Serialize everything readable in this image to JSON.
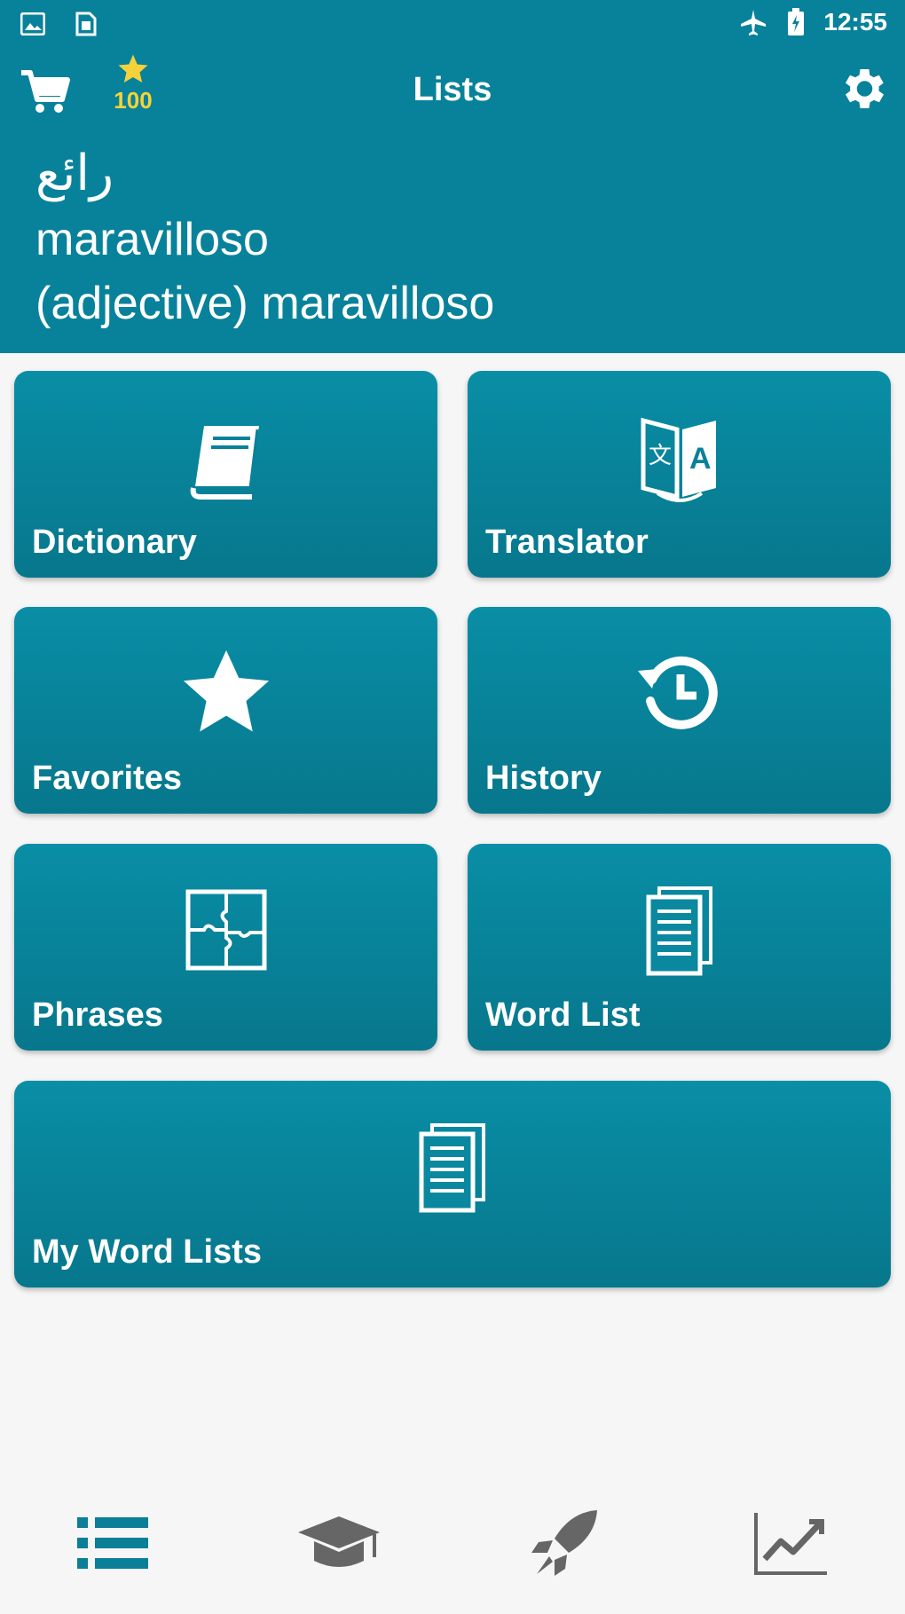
{
  "status_bar": {
    "time": "12:55",
    "left_icons": [
      "image-icon",
      "sim-icon"
    ],
    "right_icons": [
      "airplane-icon",
      "battery-icon"
    ]
  },
  "app_bar": {
    "title": "Lists",
    "coins": "100",
    "cart_icon": "cart-icon",
    "settings_icon": "gear-icon"
  },
  "word_of_day": {
    "arabic": "رائع",
    "translation": "maravilloso",
    "definition": "(adjective) maravilloso"
  },
  "tiles": [
    {
      "label": "Dictionary",
      "icon": "book-icon"
    },
    {
      "label": "Translator",
      "icon": "translate-icon"
    },
    {
      "label": "Favorites",
      "icon": "star-icon"
    },
    {
      "label": "History",
      "icon": "history-icon"
    },
    {
      "label": "Phrases",
      "icon": "puzzle-icon"
    },
    {
      "label": "Word List",
      "icon": "document-list-icon"
    },
    {
      "label": "My Word Lists",
      "icon": "document-list-icon"
    }
  ],
  "bottom_nav": [
    {
      "icon": "list-icon",
      "active": true
    },
    {
      "icon": "graduation-cap-icon",
      "active": false
    },
    {
      "icon": "rocket-icon",
      "active": false
    },
    {
      "icon": "trending-chart-icon",
      "active": false
    }
  ],
  "colors": {
    "primary": "#08829a",
    "tile_top": "#098ea6",
    "tile_bottom": "#07778c",
    "coin": "#f6d23a",
    "nav_active": "#0b7f97",
    "nav_inactive": "#666666"
  }
}
